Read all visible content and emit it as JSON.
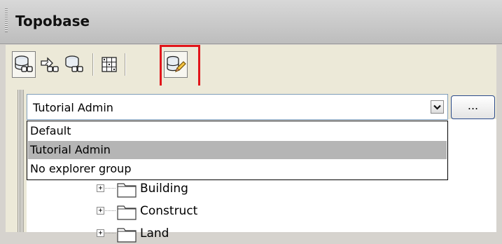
{
  "panel": {
    "title": "Topobase"
  },
  "toolbar": {
    "buttons": [
      {
        "icon": "search-database-icon"
      },
      {
        "icon": "find-arrows-icon"
      },
      {
        "icon": "search-layers-icon"
      },
      {
        "icon": "grid-icon"
      },
      {
        "icon": "edit-database-icon",
        "highlighted": true
      }
    ]
  },
  "explorer": {
    "selected_group": "Tutorial Admin",
    "more_button_label": "...",
    "options": [
      "Default",
      "Tutorial Admin",
      "No explorer group"
    ]
  },
  "tree": {
    "items": [
      {
        "label": "Building"
      },
      {
        "label": "Construct"
      },
      {
        "label": "Land"
      }
    ]
  },
  "colors": {
    "highlight": "#e1151a",
    "selected_row": "#b5b5b5"
  }
}
